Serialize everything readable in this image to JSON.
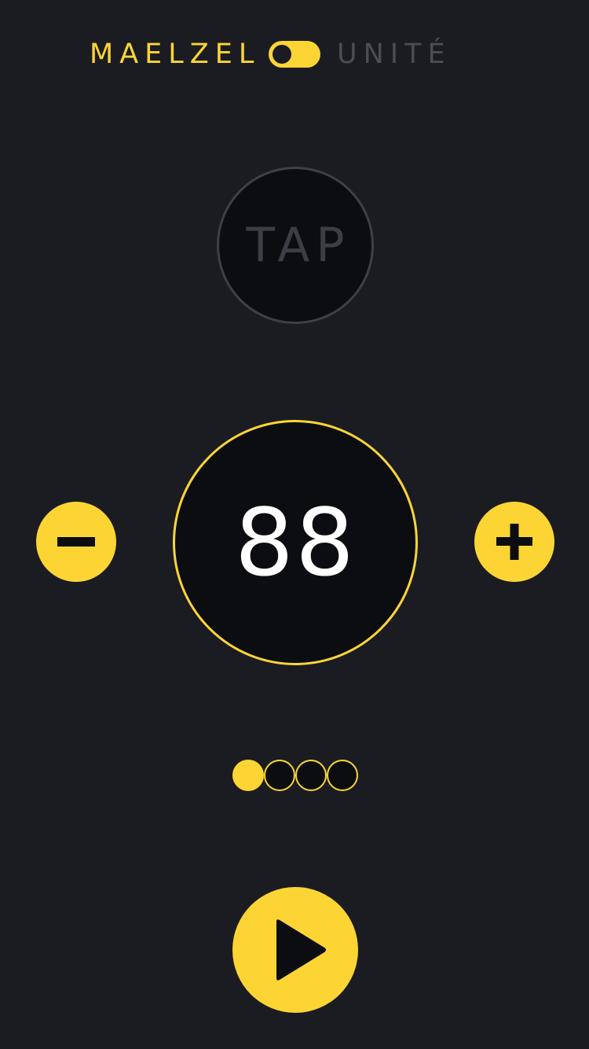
{
  "mode_toggle": {
    "left_label": "MAELZEL",
    "right_label": "UNITÉ",
    "state": "left"
  },
  "tap_button": {
    "label": "TAP"
  },
  "tempo": {
    "value": "88"
  },
  "controls": {
    "decrease_icon": "minus-icon",
    "increase_icon": "plus-icon",
    "play_icon": "play-icon"
  },
  "beats": {
    "count": 4,
    "active_index": 0
  },
  "colors": {
    "accent": "#fcd535",
    "background": "#1b1c21",
    "circle_fill": "#0c0d10",
    "muted": "#4a4d55"
  }
}
